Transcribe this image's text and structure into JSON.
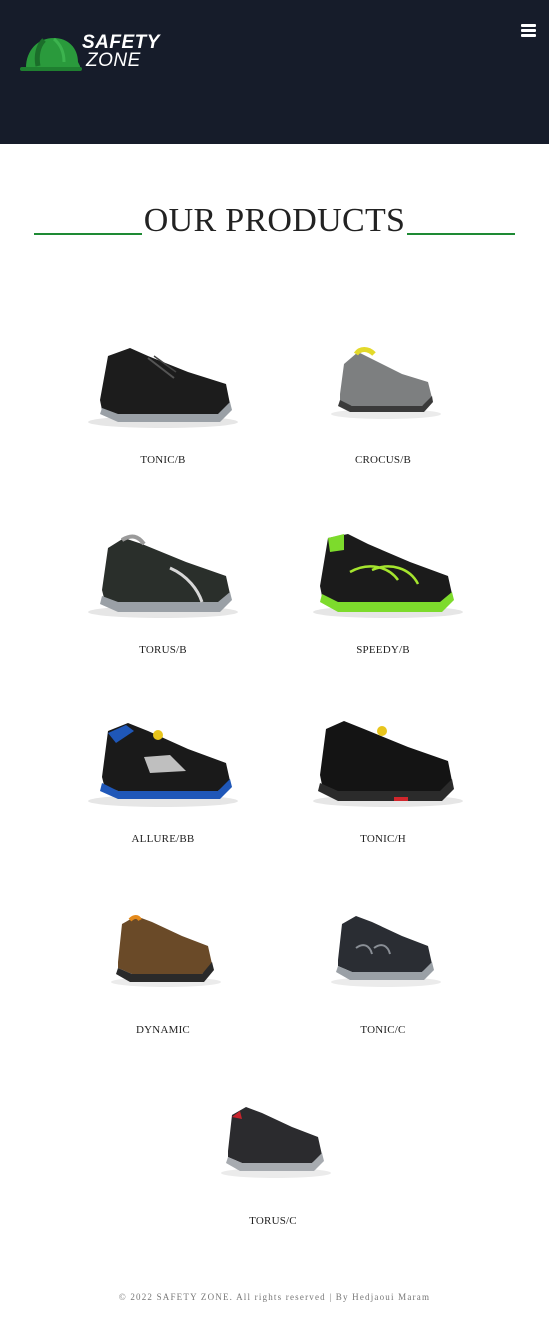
{
  "header": {
    "logo_line1": "SAFETY",
    "logo_line2": "ZONE",
    "logo_icon": "helmet-icon",
    "menu_icon": "hamburger-menu-icon",
    "colors": {
      "background": "#161c2a",
      "brand_green": "#1e8a34"
    }
  },
  "main": {
    "title": "OUR PRODUCTS",
    "products": [
      {
        "name": "TONIC/B"
      },
      {
        "name": "CROCUS/B"
      },
      {
        "name": "TORUS/B"
      },
      {
        "name": "SPEEDY/B"
      },
      {
        "name": "ALLURE/BB"
      },
      {
        "name": "TONIC/H"
      },
      {
        "name": "DYNAMIC"
      },
      {
        "name": "TONIC/C"
      },
      {
        "name": "TORUS/C"
      }
    ]
  },
  "footer": {
    "text": "© 2022 SAFETY ZONE. All rights reserved | By Hedjaoui Maram"
  }
}
